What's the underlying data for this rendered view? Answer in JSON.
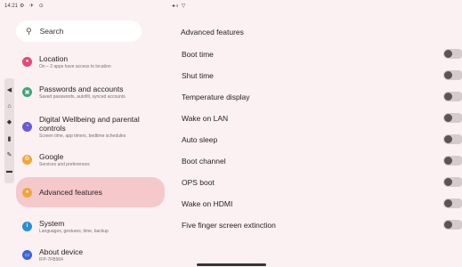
{
  "statusbar": {
    "time": "14:21",
    "icons": "⚙ ✈ ⊙",
    "right": "◂◃ ▽"
  },
  "rail": [
    "back-arrow-icon",
    "home-icon",
    "layers-icon",
    "phone-icon",
    "edit-icon",
    "briefcase-icon"
  ],
  "search": {
    "placeholder": "Search"
  },
  "settings": [
    {
      "title": "Location",
      "sub": "On – 2 apps have access to location",
      "color": "#e8467c",
      "glyph": "●"
    },
    {
      "title": "Passwords and accounts",
      "sub": "Saved passwords, autofill, synced accounts",
      "color": "#3fa57a",
      "glyph": "▣"
    },
    {
      "title": "Digital Wellbeing and parental controls",
      "sub": "Screen time, app timers, bedtime schedules",
      "color": "#6b5bd6",
      "glyph": "◔"
    },
    {
      "title": "Google",
      "sub": "Services and preferences",
      "color": "#f0a63a",
      "glyph": "G"
    },
    {
      "title": "Advanced features",
      "sub": "",
      "color": "#f0a63a",
      "glyph": "●"
    },
    {
      "title": "System",
      "sub": "Languages, gestures, time, backup",
      "color": "#2a8fd6",
      "glyph": "i"
    },
    {
      "title": "About device",
      "sub": "IFP-7FB964",
      "color": "#3b64d6",
      "glyph": "▭"
    }
  ],
  "detail": {
    "header": "Advanced features",
    "options": [
      {
        "label": "Boot time",
        "enabled": false
      },
      {
        "label": "Shut time",
        "enabled": false
      },
      {
        "label": "Temperature display",
        "enabled": false
      },
      {
        "label": "Wake on LAN",
        "enabled": false
      },
      {
        "label": "Auto sleep",
        "enabled": false
      },
      {
        "label": "Boot channel",
        "enabled": false
      },
      {
        "label": "OPS boot",
        "enabled": false
      },
      {
        "label": "Wake on HDMI",
        "enabled": false
      },
      {
        "label": "Five finger screen extinction",
        "enabled": false
      }
    ]
  }
}
